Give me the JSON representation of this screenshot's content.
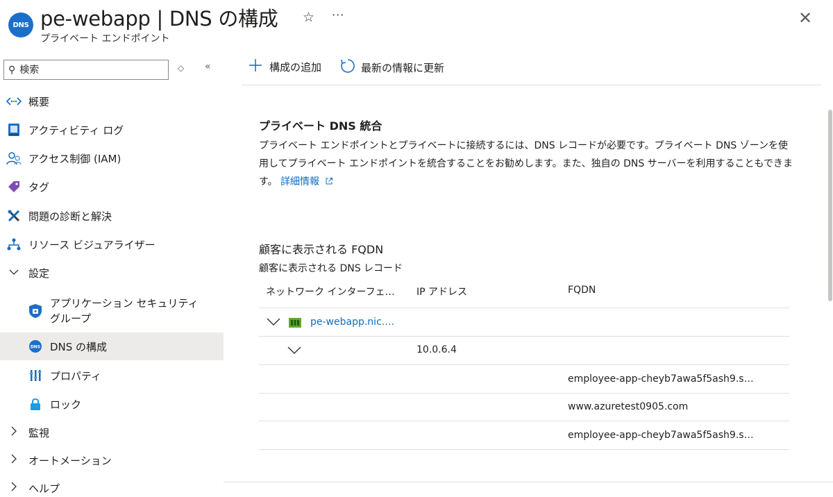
{
  "header": {
    "icon_text": "DNS",
    "title": "pe-webapp | DNS の構成",
    "subtitle": "プライベート エンドポイント",
    "star": "☆",
    "more": "···",
    "close": "✕"
  },
  "sidebar": {
    "search_placeholder": "検索",
    "items": [
      {
        "label": "概要",
        "icon": "overview-icon"
      },
      {
        "label": "アクティビティ ログ",
        "icon": "activity-log-icon"
      },
      {
        "label": "アクセス制御 (IAM)",
        "icon": "iam-icon"
      },
      {
        "label": "タグ",
        "icon": "tag-icon"
      },
      {
        "label": "問題の診断と解決",
        "icon": "diagnose-icon"
      },
      {
        "label": "リソース ビジュアライザー",
        "icon": "resource-visualizer-icon"
      },
      {
        "label": "設定",
        "icon": "chevron-down-icon"
      },
      {
        "label": "アプリケーション セキュリティ",
        "label2": "グループ",
        "icon": "asg-icon"
      },
      {
        "label": "DNS の構成",
        "icon": "dns-icon",
        "active": true
      },
      {
        "label": "プロパティ",
        "icon": "properties-icon"
      },
      {
        "label": "ロック",
        "icon": "lock-icon"
      },
      {
        "label": "監視",
        "icon": "chevron-right-icon"
      },
      {
        "label": "オートメーション",
        "icon": "chevron-right-icon"
      },
      {
        "label": "ヘルプ",
        "icon": "chevron-right-icon"
      }
    ]
  },
  "toolbar": {
    "add_label": "構成の追加",
    "refresh_label": "最新の情報に更新"
  },
  "main": {
    "dns_section_title": "プライベート DNS 統合",
    "dns_description": "プライベート エンドポイントとプライベートに接続するには、DNS レコードが必要です。プライベート DNS ゾーンを使用してプライベート エンドポイントを統合することをお勧めします。また、独自の DNS サーバーを利用することもできます。",
    "learn_more": "詳細情報",
    "fqdn_section_title": "顧客に表示される FQDN",
    "records_label": "顧客に表示される DNS レコード",
    "table": {
      "headers": [
        "ネットワーク インターフェ…",
        "IP アドレス",
        "FQDN"
      ],
      "nic_name": "pe-webapp.nic.…",
      "ip": "10.0.6.4",
      "fqdns": [
        "employee-app-cheyb7awa5f5ash9.s…",
        "www.azuretest0905.com",
        "employee-app-cheyb7awa5f5ash9.s…"
      ]
    }
  },
  "colors": {
    "accent": "#0f6cbd",
    "active_bg": "#edebe9"
  }
}
